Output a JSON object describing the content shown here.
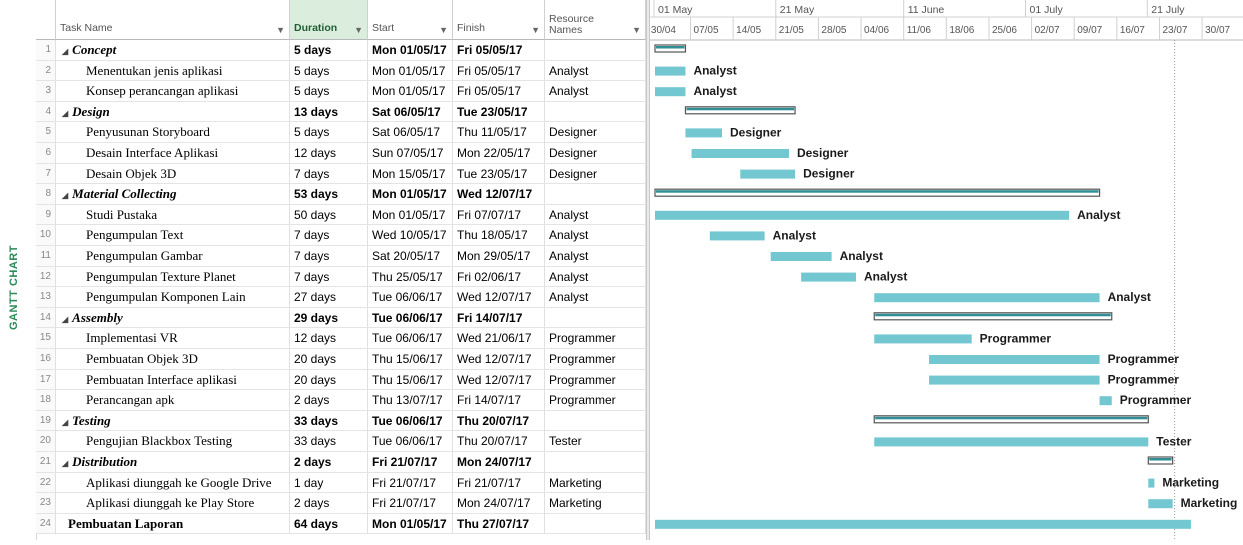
{
  "side_label": "GANTT CHART",
  "headers": {
    "task_name": "Task Name",
    "duration": "Duration",
    "start": "Start",
    "finish": "Finish",
    "resource_line1": "Resource",
    "resource_line2": "Names"
  },
  "timeline": {
    "major": [
      "01 May",
      "21 May",
      "11 June",
      "01 July",
      "21 July"
    ],
    "minor": [
      "30/04",
      "07/05",
      "14/05",
      "21/05",
      "28/05",
      "04/06",
      "11/06",
      "18/06",
      "25/06",
      "02/07",
      "09/07",
      "16/07",
      "23/07",
      "30/07"
    ]
  },
  "tasks": [
    {
      "id": "1",
      "name": "Concept",
      "duration": "5 days",
      "start": "Mon 01/05/17",
      "finish": "Fri 05/05/17",
      "resource": "",
      "type": "summary",
      "s": 1,
      "e": 5
    },
    {
      "id": "2",
      "name": "Menentukan jenis aplikasi",
      "duration": "5 days",
      "start": "Mon 01/05/17",
      "finish": "Fri 05/05/17",
      "resource": "Analyst",
      "type": "task",
      "s": 1,
      "e": 5
    },
    {
      "id": "3",
      "name": "Konsep perancangan aplikasi",
      "duration": "5 days",
      "start": "Mon 01/05/17",
      "finish": "Fri 05/05/17",
      "resource": "Analyst",
      "type": "task",
      "s": 1,
      "e": 5
    },
    {
      "id": "4",
      "name": "Design",
      "duration": "13 days",
      "start": "Sat 06/05/17",
      "finish": "Tue 23/05/17",
      "resource": "",
      "type": "summary",
      "s": 6,
      "e": 23
    },
    {
      "id": "5",
      "name": "Penyusunan Storyboard",
      "duration": "5 days",
      "start": "Sat 06/05/17",
      "finish": "Thu 11/05/17",
      "resource": "Designer",
      "type": "task",
      "s": 6,
      "e": 11
    },
    {
      "id": "6",
      "name": "Desain Interface Aplikasi",
      "duration": "12 days",
      "start": "Sun 07/05/17",
      "finish": "Mon 22/05/17",
      "resource": "Designer",
      "type": "task",
      "s": 7,
      "e": 22
    },
    {
      "id": "7",
      "name": "Desain Objek 3D",
      "duration": "7 days",
      "start": "Mon 15/05/17",
      "finish": "Tue 23/05/17",
      "resource": "Designer",
      "type": "task",
      "s": 15,
      "e": 23
    },
    {
      "id": "8",
      "name": "Material Collecting",
      "duration": "53 days",
      "start": "Mon 01/05/17",
      "finish": "Wed 12/07/17",
      "resource": "",
      "type": "summary",
      "s": 1,
      "e": 73
    },
    {
      "id": "9",
      "name": "Studi Pustaka",
      "duration": "50 days",
      "start": "Mon 01/05/17",
      "finish": "Fri 07/07/17",
      "resource": "Analyst",
      "type": "task",
      "s": 1,
      "e": 68
    },
    {
      "id": "10",
      "name": "Pengumpulan Text",
      "duration": "7 days",
      "start": "Wed 10/05/17",
      "finish": "Thu 18/05/17",
      "resource": "Analyst",
      "type": "task",
      "s": 10,
      "e": 18
    },
    {
      "id": "11",
      "name": "Pengumpulan Gambar",
      "duration": "7 days",
      "start": "Sat 20/05/17",
      "finish": "Mon 29/05/17",
      "resource": "Analyst",
      "type": "task",
      "s": 20,
      "e": 29
    },
    {
      "id": "12",
      "name": "Pengumpulan Texture Planet",
      "duration": "7 days",
      "start": "Thu 25/05/17",
      "finish": "Fri 02/06/17",
      "resource": "Analyst",
      "type": "task",
      "s": 25,
      "e": 33
    },
    {
      "id": "13",
      "name": "Pengumpulan Komponen Lain",
      "duration": "27 days",
      "start": "Tue 06/06/17",
      "finish": "Wed 12/07/17",
      "resource": "Analyst",
      "type": "task",
      "s": 37,
      "e": 73
    },
    {
      "id": "14",
      "name": "Assembly",
      "duration": "29 days",
      "start": "Tue 06/06/17",
      "finish": "Fri 14/07/17",
      "resource": "",
      "type": "summary",
      "s": 37,
      "e": 75
    },
    {
      "id": "15",
      "name": "Implementasi VR",
      "duration": "12 days",
      "start": "Tue 06/06/17",
      "finish": "Wed 21/06/17",
      "resource": "Programmer",
      "type": "task",
      "s": 37,
      "e": 52
    },
    {
      "id": "16",
      "name": "Pembuatan Objek 3D",
      "duration": "20 days",
      "start": "Thu 15/06/17",
      "finish": "Wed 12/07/17",
      "resource": "Programmer",
      "type": "task",
      "s": 46,
      "e": 73
    },
    {
      "id": "17",
      "name": "Pembuatan Interface aplikasi",
      "duration": "20 days",
      "start": "Thu 15/06/17",
      "finish": "Wed 12/07/17",
      "resource": "Programmer",
      "type": "task",
      "s": 46,
      "e": 73
    },
    {
      "id": "18",
      "name": "Perancangan apk",
      "duration": "2 days",
      "start": "Thu 13/07/17",
      "finish": "Fri 14/07/17",
      "resource": "Programmer",
      "type": "task",
      "s": 74,
      "e": 75
    },
    {
      "id": "19",
      "name": "Testing",
      "duration": "33 days",
      "start": "Tue 06/06/17",
      "finish": "Thu 20/07/17",
      "resource": "",
      "type": "summary",
      "s": 37,
      "e": 81
    },
    {
      "id": "20",
      "name": "Pengujian Blackbox Testing",
      "duration": "33 days",
      "start": "Tue 06/06/17",
      "finish": "Thu 20/07/17",
      "resource": "Tester",
      "type": "task",
      "s": 37,
      "e": 81
    },
    {
      "id": "21",
      "name": "Distribution",
      "duration": "2 days",
      "start": "Fri 21/07/17",
      "finish": "Mon 24/07/17",
      "resource": "",
      "type": "summary",
      "s": 82,
      "e": 85
    },
    {
      "id": "22",
      "name": "Aplikasi diunggah ke Google Drive",
      "duration": "1 day",
      "start": "Fri 21/07/17",
      "finish": "Fri 21/07/17",
      "resource": "Marketing",
      "type": "task",
      "s": 82,
      "e": 82
    },
    {
      "id": "23",
      "name": "Aplikasi diunggah ke Play Store",
      "duration": "2 days",
      "start": "Fri 21/07/17",
      "finish": "Mon 24/07/17",
      "resource": "Marketing",
      "type": "task",
      "s": 82,
      "e": 85
    },
    {
      "id": "24",
      "name": "Pembuatan Laporan",
      "duration": "64 days",
      "start": "Mon 01/05/17",
      "finish": "Thu 27/07/17",
      "resource": "",
      "type": "toplevel",
      "s": 1,
      "e": 88
    }
  ],
  "colors": {
    "task_bar": "#72c7d0",
    "summary_bar": "#2f8f95",
    "header_active": "#dbeedd"
  }
}
